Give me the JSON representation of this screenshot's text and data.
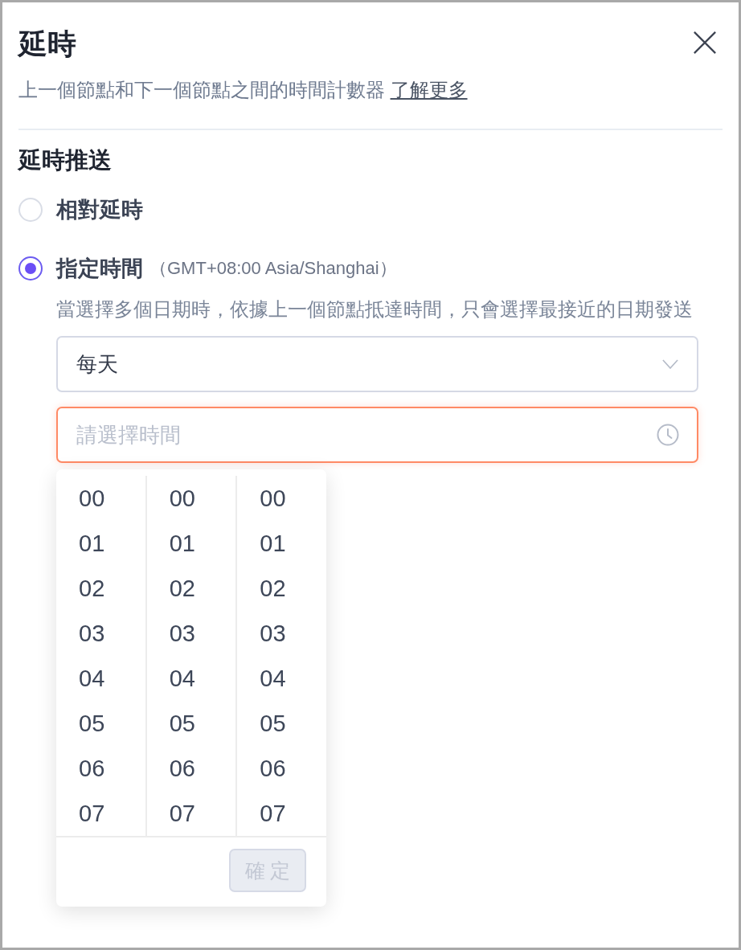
{
  "dialog": {
    "title": "延時",
    "description": "上一個節點和下一個節點之間的時間計數器",
    "learn_more_link": "了解更多"
  },
  "section": {
    "title": "延時推送",
    "options": [
      {
        "label": "相對延時",
        "selected": false
      },
      {
        "label": "指定時間",
        "note": "（GMT+08:00 Asia/Shanghai）",
        "hint": "當選擇多個日期時，依據上一個節點抵達時間，只會選擇最接近的日期發送",
        "selected": true
      }
    ]
  },
  "repeat_select": {
    "value": "每天"
  },
  "time_field": {
    "placeholder": "請選擇時間",
    "focused": true
  },
  "time_picker": {
    "columns": [
      {
        "items": [
          "00",
          "01",
          "02",
          "03",
          "04",
          "05",
          "06",
          "07"
        ]
      },
      {
        "items": [
          "00",
          "01",
          "02",
          "03",
          "04",
          "05",
          "06",
          "07"
        ]
      },
      {
        "items": [
          "00",
          "01",
          "02",
          "03",
          "04",
          "05",
          "06",
          "07"
        ]
      }
    ],
    "confirm_button": {
      "label": "確 定",
      "disabled": true
    }
  }
}
